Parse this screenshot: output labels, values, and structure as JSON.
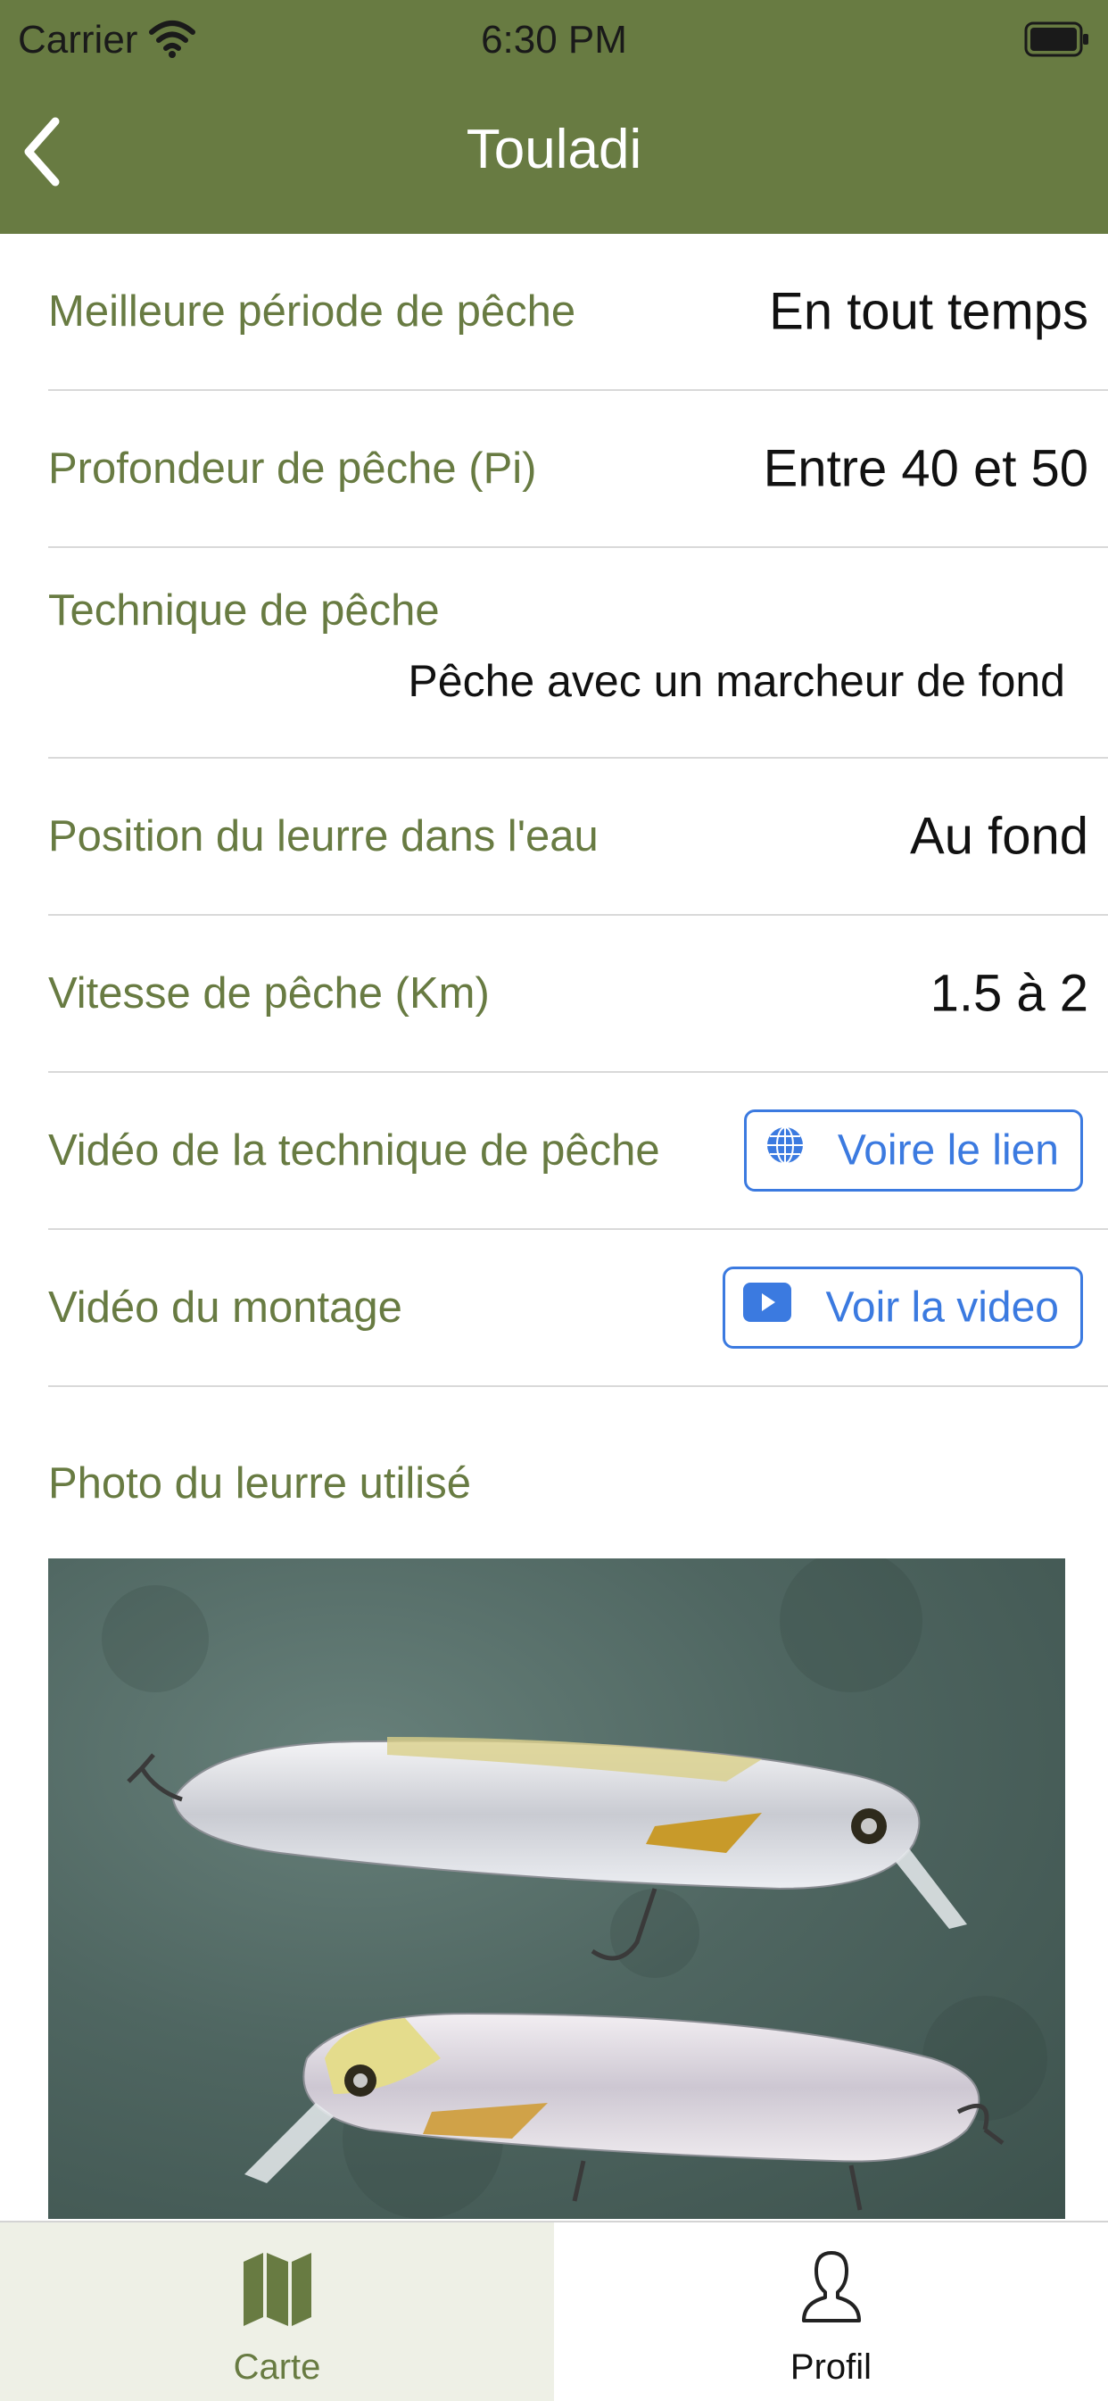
{
  "status_bar": {
    "carrier": "Carrier",
    "time": "6:30 PM"
  },
  "nav": {
    "title": "Touladi"
  },
  "rows": [
    {
      "label": "Meilleure période de pêche",
      "value": "En tout temps"
    },
    {
      "label": "Profondeur de pêche (Pi)",
      "value": "Entre 40 et 50"
    },
    {
      "label": "Technique de pêche",
      "value": "Pêche avec un marcheur de fond"
    },
    {
      "label": "Position du leurre dans l'eau",
      "value": "Au fond"
    },
    {
      "label": "Vitesse de pêche (Km)",
      "value": "1.5 à 2"
    },
    {
      "label": "Vidéo de la technique de pêche",
      "button_label": "Voire le lien"
    },
    {
      "label": "Vidéo du montage",
      "button_label": "Voir la video"
    },
    {
      "label": "Photo du leurre utilisé"
    }
  ],
  "tabs": [
    {
      "label": "Carte",
      "icon": "map-icon",
      "selected": true
    },
    {
      "label": "Profil",
      "icon": "person-icon",
      "selected": false
    }
  ],
  "colors": {
    "accent_green": "#687b42",
    "link_blue": "#3b7ae0"
  }
}
